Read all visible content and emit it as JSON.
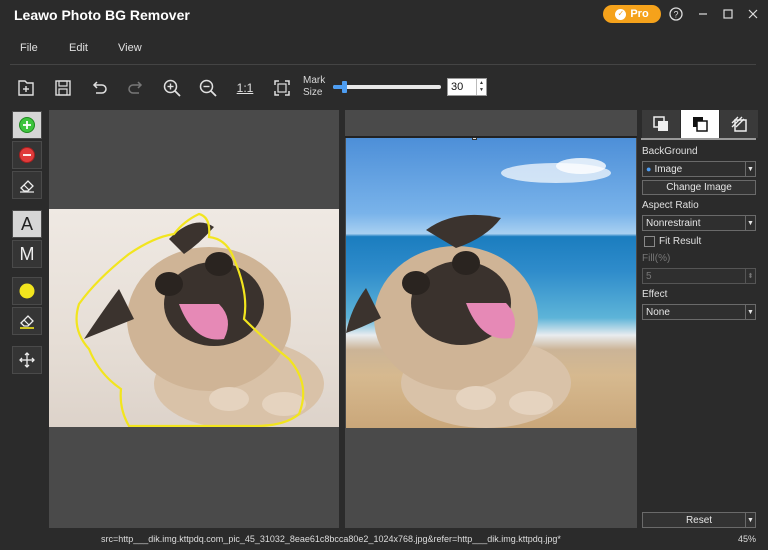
{
  "app": {
    "title": "Leawo Photo BG Remover",
    "pro_label": "Pro"
  },
  "menu": {
    "file": "File",
    "edit": "Edit",
    "view": "View"
  },
  "toolbar": {
    "ratio_label": "1:1",
    "mark_size_label_line1": "Mark",
    "mark_size_label_line2": "Size",
    "mark_size_value": "30",
    "mark_size_fraction": 0.1
  },
  "left_tools": {
    "auto_label": "A",
    "manual_label": "M"
  },
  "panel": {
    "background_label": "BackGround",
    "background_value": "Image",
    "change_image_label": "Change Image",
    "aspect_ratio_label": "Aspect Ratio",
    "aspect_ratio_value": "Nonrestraint",
    "fit_result_label": "Fit Result",
    "fill_label": "Fill(%)",
    "fill_value": "5",
    "effect_label": "Effect",
    "effect_value": "None",
    "reset_label": "Reset"
  },
  "status": {
    "source": "src=http___dik.img.kttpdq.com_pic_45_31032_8eae61c8bcca80e2_1024x768.jpg&refer=http___dik.img.kttpdq.jpg*",
    "zoom": "45%"
  },
  "colors": {
    "accent": "#4d9df2",
    "pro": "#f5a21b",
    "outline": "#f2e51e",
    "add": "#3ec43e",
    "remove": "#e03b3b"
  }
}
